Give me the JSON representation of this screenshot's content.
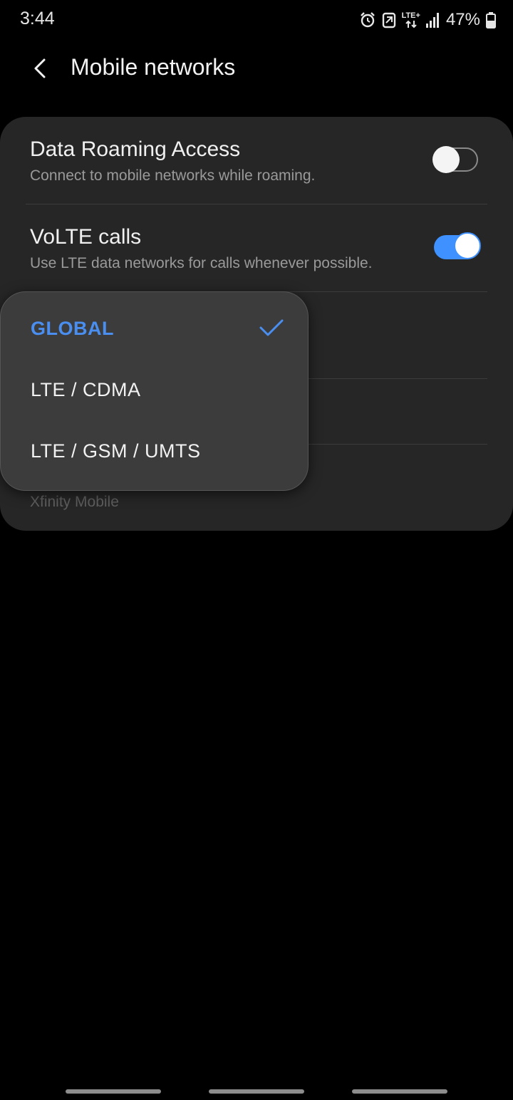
{
  "status_bar": {
    "time": "3:44",
    "network_type": "LTE+",
    "battery": "47%",
    "icons": [
      "alarm-icon",
      "nfc-icon",
      "lte-icon",
      "signal-icon",
      "battery-icon"
    ]
  },
  "header": {
    "title": "Mobile networks",
    "back_icon": "back-arrow-icon"
  },
  "settings": {
    "data_roaming": {
      "title": "Data Roaming Access",
      "subtitle": "Connect to mobile networks while roaming.",
      "enabled": false
    },
    "volte": {
      "title": "VoLTE calls",
      "subtitle": "Use LTE data networks for calls whenever possible.",
      "enabled": true
    },
    "network_operator_value": "Xfinity Mobile"
  },
  "network_mode_dropdown": {
    "options": [
      {
        "label": "GLOBAL",
        "selected": true
      },
      {
        "label": "LTE / CDMA",
        "selected": false
      },
      {
        "label": "LTE / GSM / UMTS",
        "selected": false
      }
    ]
  },
  "colors": {
    "accent": "#3e91ff",
    "selected_text": "#4a8ef0",
    "card_background": "#262626",
    "dropdown_background": "#3c3c3c"
  }
}
